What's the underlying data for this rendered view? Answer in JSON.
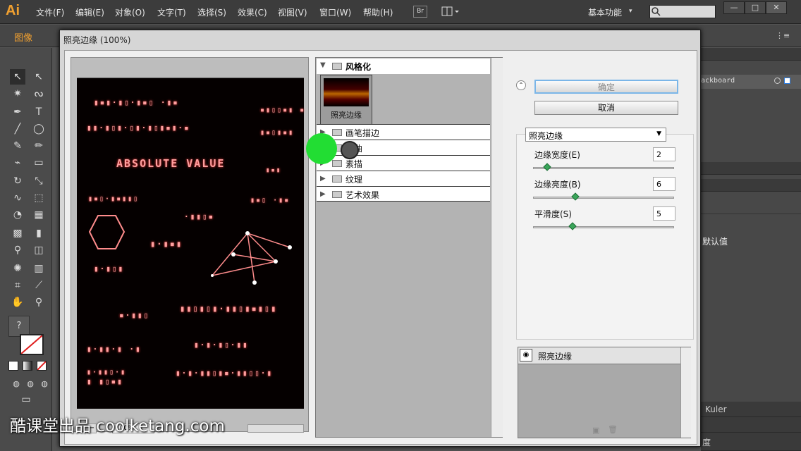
{
  "app": {
    "logo": "Ai",
    "menu": [
      "文件(F)",
      "编辑(E)",
      "对象(O)",
      "文字(T)",
      "选择(S)",
      "效果(C)",
      "视图(V)",
      "窗口(W)",
      "帮助(H)"
    ],
    "bridge": "Br",
    "workspace": "基本功能",
    "window_buttons": [
      "—",
      "□",
      "✕"
    ]
  },
  "control_bar": {
    "label": "图像"
  },
  "right_panel": {
    "artboard": "ackboard",
    "default_text": "默认值",
    "kuler": "Kuler",
    "bottom_text": "度"
  },
  "dialog": {
    "title": "照亮边缘 (100%)",
    "preview": {
      "zoom": "100%",
      "lines": [
        "ABSOLUTE VALUE"
      ]
    },
    "tree": {
      "expanded_category": "风格化",
      "thumb_label": "照亮边缘",
      "categories": [
        "画笔描边",
        "扭曲",
        "素描",
        "纹理",
        "艺术效果"
      ]
    },
    "ok": "确定",
    "cancel": "取消",
    "selected_filter": "照亮边缘",
    "params": [
      {
        "label": "边缘宽度(E)",
        "value": "2",
        "fraction": 0.1
      },
      {
        "label": "边缘亮度(B)",
        "value": "6",
        "fraction": 0.3
      },
      {
        "label": "平滑度(S)",
        "value": "5",
        "fraction": 0.28
      }
    ],
    "layer_name": "照亮边缘"
  },
  "watermark": "酷课堂出品 coolketang.com",
  "colors": {
    "accent": "#f0a030",
    "glow": "#ff9f9f",
    "cursor": "#22dd33",
    "ok_border": "#7bb6e8"
  }
}
